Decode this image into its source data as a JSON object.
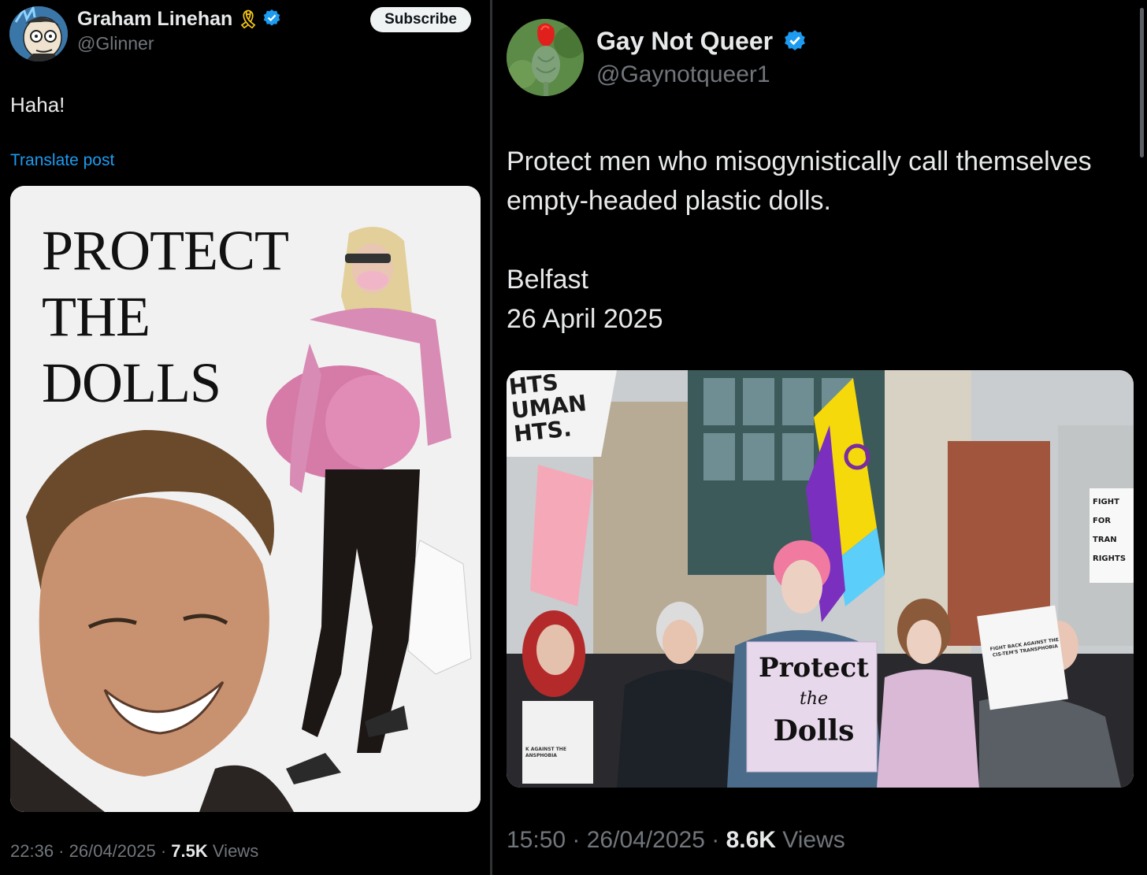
{
  "left_post": {
    "author_name": "Graham Linehan",
    "ribbon_icon": "yellow-ribbon-icon",
    "handle": "@Glinner",
    "subscribe_label": "Subscribe",
    "text": "Haha!",
    "translate_label": "Translate post",
    "image": {
      "poster_lines": [
        "PROTECT",
        "THE",
        "DOLLS"
      ]
    },
    "time": "22:36",
    "date": "26/04/2025",
    "views_count": "7.5K",
    "views_label": "Views"
  },
  "right_post": {
    "author_name": "Gay Not Queer",
    "handle": "@Gaynotqueer1",
    "text_line1": "Protect men who misogynistically call themselves empty-headed plastic dolls.",
    "location": "Belfast",
    "date_text": "26 April 2025",
    "image": {
      "sign_top_lines": [
        "HTS",
        "UMAN",
        "HTS."
      ],
      "main_sign_lines": [
        "Protect",
        "the",
        "Dolls"
      ],
      "fist_sign_lines": [
        "FIGHT BACK AGAINST THE",
        "CIS-TEM'S TRANSPHOBIA"
      ],
      "small_sign_lines": [
        "K AGAINST THE",
        "ANSPHOBIA"
      ],
      "right_sign_lines": [
        "FIGHT",
        "FOR",
        "TRAN",
        "RIGHTS"
      ]
    },
    "time": "15:50",
    "date": "26/04/2025",
    "views_count": "8.6K",
    "views_label": "Views"
  },
  "colors": {
    "background": "#000000",
    "text": "#e7e9ea",
    "muted": "#71767b",
    "link": "#1d9bf0",
    "verified": "#1d9bf0"
  }
}
